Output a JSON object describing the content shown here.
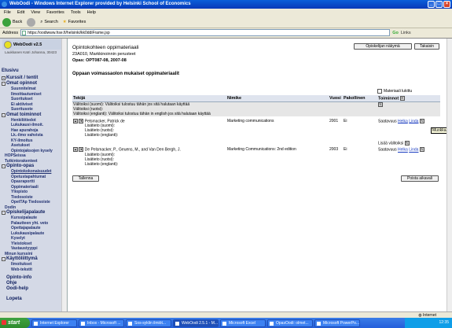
{
  "window": {
    "title": "WebOodi - Windows Internet Explorer provided by Helsinki School of Economics"
  },
  "menu": [
    "File",
    "Edit",
    "View",
    "Favorites",
    "Tools",
    "Help"
  ],
  "toolbar": {
    "back": "Back",
    "search": "Search",
    "favorites": "Favorites"
  },
  "address": {
    "label": "Address",
    "url": "https://oodiwww.hse.fi/helsinki/kk0ddiFrame.jsp",
    "go": "Go",
    "links": "Links"
  },
  "sidebar": {
    "app_name": "WebOodi v2.5",
    "user": "Laukkanen Katri Johanna, 30423",
    "home": "Etusivu",
    "groups": [
      {
        "label": "Kurssit / tentit",
        "items": []
      },
      {
        "label": "Omat opinnot",
        "items": [
          "Suunnitelmat",
          "Ilmoittautumiset",
          "Suoritukset",
          "Ei aktiiviset",
          "Suoritusote"
        ]
      },
      {
        "label": "Omat toiminnot",
        "items": [
          "Henkilötiedot",
          "Lukukausi-ilmoit.",
          "Hae apurahoja",
          "Lk.-ilmo vahvista",
          "KY-ilmoitus",
          "Asetukset",
          "Opintojaksojen kysely"
        ]
      }
    ],
    "flat_items": [
      "HOPSeissa",
      "Tutkintorakenteet"
    ],
    "opinto_opas": {
      "label": "Opinto-opas",
      "items": [
        "Opintokokonaisuudet",
        "Opetustapahtumat",
        "Opasraportti",
        "Oppimateriaali",
        "Yliopisto",
        "Tiedosoiste",
        "OpetTAp Tiedosoiste",
        "Dodin"
      ]
    },
    "palaute": {
      "label": "Opiskelijapalaute",
      "items": [
        "Kurssipalaute",
        "Palautteen yht. veto",
        "Opettajapalaute",
        "Lukukausipalaute",
        "Kyselyt",
        "Yleistokset",
        "Vastaustyyppi"
      ]
    },
    "minun": "Minun kurssini",
    "kaytto": {
      "label": "Käyttöliittymä",
      "items": [
        "Ilmoitukset",
        "Web-tekstit"
      ]
    },
    "bottom": [
      "Opinto-info",
      "Ohje",
      "Oodi-help"
    ],
    "logout": "Lopeta"
  },
  "main": {
    "title": "Opintokohteen oppimateriaali",
    "code": "23A010, Markkinoinnin perusteet",
    "opas": "Opas: OPT087-08, 2007-08",
    "subtitle": "Oppaan voimassaolon mukaiset oppimateriaalit",
    "btn_opiskelijan": "Opiskelijan näkymä",
    "btn_takaisin": "Takaisin",
    "check_label": "Materiaali lukittu",
    "columns": [
      "Tekijä",
      "Nimike",
      "Vuosi",
      "Pakollinen",
      "Toiminnot"
    ],
    "valitoiksi_fi": "Välitoiksi (suomi): Välitoiksi tulostuu tähän jos sitä halutaan käyttää",
    "valitoiksi_ruotsi": "Välitoiksi (ruotsi):",
    "valitoiksi_en": "Välitoiksi (englanti): Välitoiksi tulostuu tähän in english jos sitä halutaan käyttää",
    "rows": [
      {
        "author": "Pelsmacker, Patrick de",
        "title": "Marketing communications",
        "year": "2001",
        "mandatory": "Ei",
        "avail": "Saatavuus",
        "link1": "Helka",
        "link2": "Linda",
        "info": [
          "Lisätieto (suomi):",
          "Lisätieto (ruotsi):",
          "Lisätieto (englanti):"
        ]
      },
      {
        "author": "De Pelsmacker, P., Geuens, M., and Van Den Bergh, J.",
        "title": "Marketing Communications: 2nd edition",
        "year": "2003",
        "mandatory": "Ei",
        "avail": "Saatavuus",
        "link1": "Helka",
        "link2": "Linda",
        "info": [
          "Lisätieto (suomi):",
          "Lisätieto (ruotsi):",
          "Lisätieto (englanti):"
        ]
      }
    ],
    "lisaa": "Lisää välitoiksi",
    "tooltip": "Muokkaa",
    "btn_tallenna": "Tallenna",
    "btn_poista": "Poista aikavali"
  },
  "status": {
    "zone": "Internet"
  },
  "taskbar": {
    "start": "start",
    "tasks": [
      "Internet Explorer",
      "Inbox - Microsoft ...",
      "Sos-syklin ilmiöt...",
      "WebOodi 2.5.1 - M...",
      "Microsoft Excel",
      "OpasOodi: olmet...",
      "Microsoft PowerPo..."
    ],
    "clock": "12:35"
  }
}
